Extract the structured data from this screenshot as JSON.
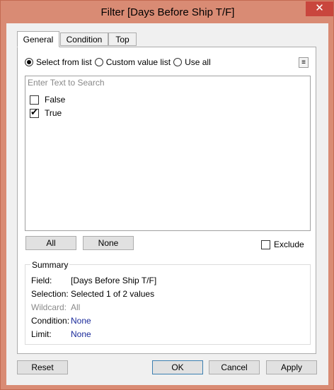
{
  "window": {
    "title": "Filter [Days Before Ship T/F]",
    "close_glyph": "✕"
  },
  "tabs": [
    {
      "label": "General",
      "active": true
    },
    {
      "label": "Condition",
      "active": false
    },
    {
      "label": "Top",
      "active": false
    }
  ],
  "general": {
    "radios": [
      {
        "label": "Select from list",
        "checked": true
      },
      {
        "label": "Custom value list",
        "checked": false
      },
      {
        "label": "Use all",
        "checked": false
      }
    ],
    "menu_glyph": "≡",
    "search": {
      "placeholder": "Enter Text to Search",
      "value": ""
    },
    "items": [
      {
        "label": "False",
        "checked": false
      },
      {
        "label": "True",
        "checked": true
      }
    ],
    "all_label": "All",
    "none_label": "None",
    "exclude_label": "Exclude",
    "exclude_checked": false,
    "summary": {
      "title": "Summary",
      "rows": [
        {
          "label": "Field:",
          "value": "[Days Before Ship T/F]",
          "style": "normal"
        },
        {
          "label": "Selection:",
          "value": "Selected 1 of 2 values",
          "style": "normal"
        },
        {
          "label": "Wildcard:",
          "value": "All",
          "style": "grey"
        },
        {
          "label": "Condition:",
          "value": "None",
          "style": "link"
        },
        {
          "label": "Limit:",
          "value": "None",
          "style": "link"
        }
      ]
    }
  },
  "footer": {
    "reset": "Reset",
    "ok": "OK",
    "cancel": "Cancel",
    "apply": "Apply"
  },
  "colors": {
    "frame": "#d98b74",
    "close": "#c9463d",
    "link": "#1a2a9a"
  }
}
